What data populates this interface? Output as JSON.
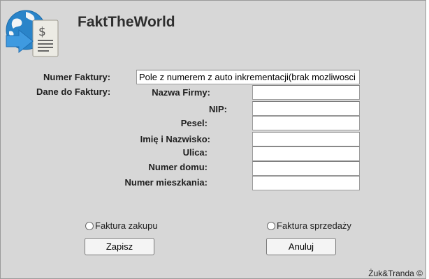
{
  "app": {
    "title": "FaktTheWorld"
  },
  "form": {
    "invoice_number_label": "Numer Faktury:",
    "invoice_number_value": "Pole z numerem z auto inkrementacji(brak mozliwosci",
    "invoice_data_label": "Dane do Faktury:",
    "fields": [
      {
        "label": "Nazwa Firmy:",
        "value": ""
      },
      {
        "label": "NIP:",
        "value": ""
      },
      {
        "label": "Pesel:",
        "value": ""
      },
      {
        "label": "Imię i Nazwisko:",
        "value": ""
      },
      {
        "label": "Ulica:",
        "value": ""
      },
      {
        "label": "Numer domu:",
        "value": ""
      },
      {
        "label": "Numer mieszkania:",
        "value": ""
      }
    ]
  },
  "invoice_type": {
    "purchase_label": "Faktura zakupu",
    "sale_label": "Faktura sprzedaży",
    "selected": "none"
  },
  "buttons": {
    "save": "Zapisz",
    "cancel": "Anuluj"
  },
  "footer": {
    "copyright": "Żuk&Tranda ©"
  },
  "icons": {
    "logo": "globe-dollar-document-icon"
  }
}
